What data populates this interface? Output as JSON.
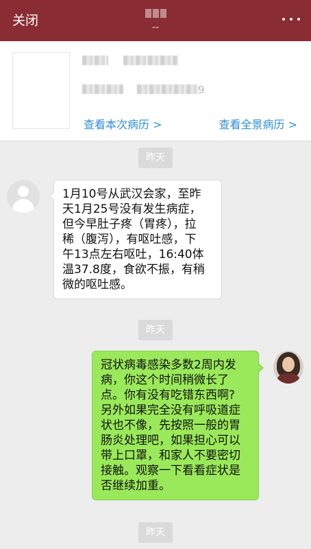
{
  "topbar": {
    "close_label": "关闭",
    "title_sub": "--",
    "more_icon": "more-dots-icon",
    "colors": {
      "background": "#8a2c33",
      "text": "#ffffff"
    }
  },
  "record_card": {
    "view_current_label": "查看本次病历 >",
    "view_full_label": "查看全景病历 >",
    "redacted_tail": "9",
    "link_color": "#2f8fd8"
  },
  "messages": [
    {
      "time": "昨天"
    },
    {
      "sender": "patient",
      "lines": [
        "1月10号从武汉会家，至昨",
        "天1月25号没有发生病症，",
        "但今早肚子疼（胃疼），拉",
        "稀（腹泻），有呕吐感，下",
        "午13点左右呕吐，16:40体",
        "温37.8度，食欲不振，有稍",
        "微的呕吐感。"
      ]
    },
    {
      "time": "昨天"
    },
    {
      "sender": "doctor",
      "lines": [
        "冠状病毒感染多数2周内发",
        "病，你这个时间稍微长了",
        "点。你有没有吃错东西啊?",
        "另外如果完全没有呼吸道症",
        "状也不像，先按照一般的胃",
        "肠炎处理吧，如果担心可以",
        "带上口罩，和家人不要密切",
        "接触。观察一下看看症状是",
        "否继续加重。"
      ],
      "bubble_color": "#9ae95a"
    },
    {
      "time": "昨天"
    }
  ]
}
